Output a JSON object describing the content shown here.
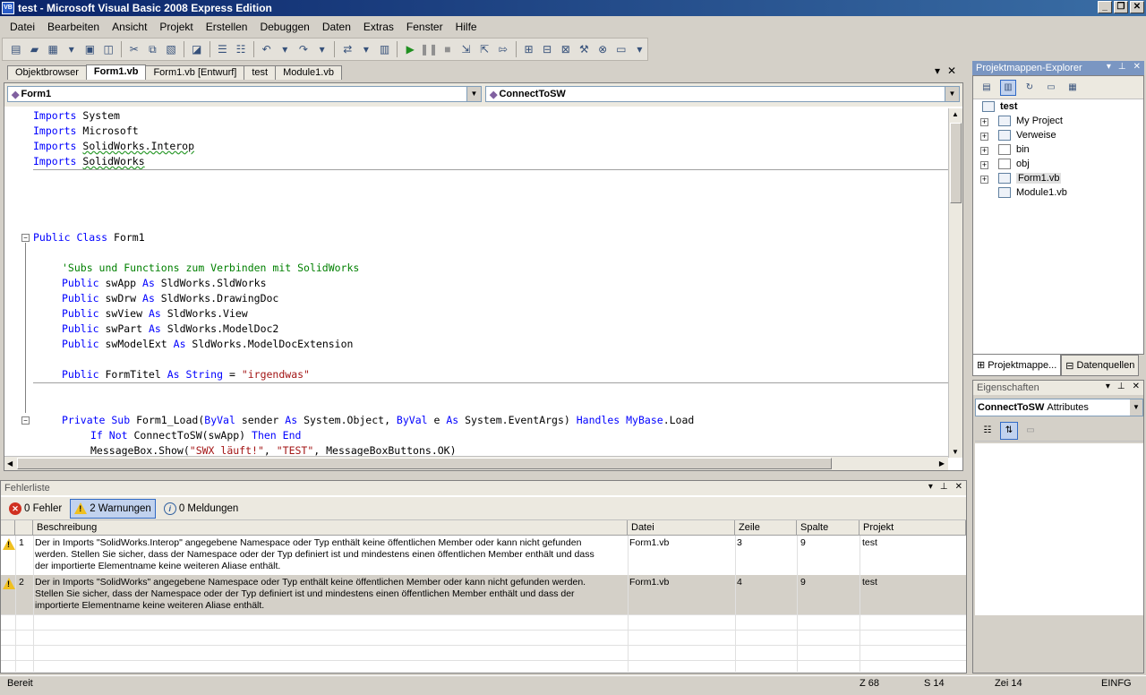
{
  "window": {
    "title": "test - Microsoft Visual Basic 2008 Express Edition",
    "icon_text": "VB",
    "minimize": "_",
    "restore": "❐",
    "close": "✕"
  },
  "menu": [
    "Datei",
    "Bearbeiten",
    "Ansicht",
    "Projekt",
    "Erstellen",
    "Debuggen",
    "Daten",
    "Extras",
    "Fenster",
    "Hilfe"
  ],
  "tabs": [
    "Objektbrowser",
    "Form1.vb",
    "Form1.vb [Entwurf]",
    "test",
    "Module1.vb"
  ],
  "active_tab": "Form1.vb",
  "editor": {
    "class_combo": "Form1",
    "member_combo": "ConnectToSW",
    "code": {
      "l1a": "Imports",
      "l1b": " System",
      "l2a": "Imports",
      "l2b": " Microsoft",
      "l3a": "Imports",
      "l3b": " ",
      "l3c": "SolidWorks.Interop",
      "l4a": "Imports",
      "l4b": " ",
      "l4c": "SolidWorks",
      "l5a": "Public Class",
      "l5b": " Form1",
      "l6": "'Subs und Functions zum Verbinden mit SolidWorks",
      "l7a": "Public",
      "l7b": " swApp ",
      "l7c": "As",
      "l7d": " SldWorks.SldWorks",
      "l8a": "Public",
      "l8b": " swDrw ",
      "l8c": "As",
      "l8d": " SldWorks.DrawingDoc",
      "l9a": "Public",
      "l9b": " swView ",
      "l9c": "As",
      "l9d": " SldWorks.View",
      "l10a": "Public",
      "l10b": " swPart ",
      "l10c": "As",
      "l10d": " SldWorks.ModelDoc2",
      "l11a": "Public",
      "l11b": " swModelExt ",
      "l11c": "As",
      "l11d": " SldWorks.ModelDocExtension",
      "l12a": "Public",
      "l12b": " FormTitel ",
      "l12c": "As String",
      "l12d": " = ",
      "l12e": "\"irgendwas\"",
      "l13a": "Private Sub",
      "l13b": " Form1_Load(",
      "l13c": "ByVal",
      "l13d": " sender ",
      "l13e": "As",
      "l13f": " System.Object, ",
      "l13g": "ByVal",
      "l13h": " e ",
      "l13i": "As",
      "l13j": " System.EventArgs) ",
      "l13k": "Handles MyBase",
      "l13l": ".Load",
      "l14a": "If Not",
      "l14b": " ConnectToSW(swApp) ",
      "l14c": "Then End",
      "l15a": "MessageBox.Show(",
      "l15b": "\"SWX läuft!\"",
      "l15c": ", ",
      "l15d": "\"TEST\"",
      "l15e": ", MessageBoxButtons.OK)"
    }
  },
  "solution_explorer": {
    "title": "Projektmappen-Explorer",
    "root": "test",
    "items": [
      "My Project",
      "Verweise",
      "bin",
      "obj",
      "Form1.vb",
      "Module1.vb"
    ],
    "tab1": "Projektmappe...",
    "tab2": "Datenquellen"
  },
  "properties": {
    "title": "Eigenschaften",
    "object": "ConnectToSW",
    "object_type": "Attributes"
  },
  "error_list": {
    "title": "Fehlerliste",
    "errors_btn": "0 Fehler",
    "warnings_btn": "2 Warnungen",
    "messages_btn": "0 Meldungen",
    "columns": [
      "Beschreibung",
      "Datei",
      "Zeile",
      "Spalte",
      "Projekt"
    ],
    "rows": [
      {
        "num": "1",
        "desc1": "Der in Imports \"SolidWorks.Interop\" angegebene Namespace oder Typ enthält keine öffentlichen Member oder kann nicht gefunden",
        "desc2": "werden. Stellen Sie sicher, dass der Namespace oder der Typ definiert ist und mindestens einen öffentlichen Member enthält und dass",
        "desc3": "der importierte Elementname keine weiteren Aliase enthält.",
        "file": "Form1.vb",
        "line": "3",
        "col": "9",
        "project": "test"
      },
      {
        "num": "2",
        "desc1": "Der in Imports \"SolidWorks\" angegebene Namespace oder Typ enthält keine öffentlichen Member oder kann nicht gefunden werden.",
        "desc2": "Stellen Sie sicher, dass der Namespace oder der Typ definiert ist und mindestens einen öffentlichen Member enthält und dass der",
        "desc3": "importierte Elementname keine weiteren Aliase enthält.",
        "file": "Form1.vb",
        "line": "4",
        "col": "9",
        "project": "test"
      }
    ]
  },
  "status": {
    "ready": "Bereit",
    "col": "Z 68",
    "char": "S 14",
    "line": "Zei 14",
    "mode": "EINFG"
  }
}
